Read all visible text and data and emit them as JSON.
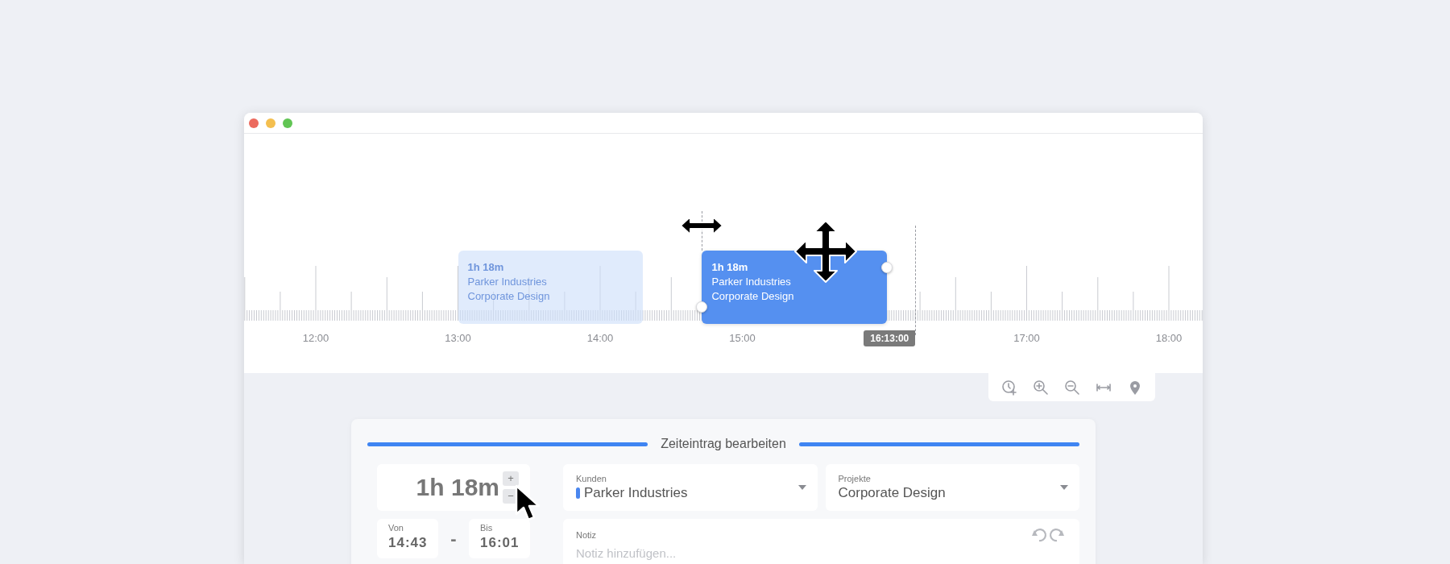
{
  "timeline": {
    "hour_labels": [
      "12:00",
      "13:00",
      "14:00",
      "15:00",
      "17:00",
      "18:00"
    ],
    "entries": [
      {
        "kind": "ghost",
        "duration": "1h 18m",
        "client": "Parker Industries",
        "project": "Corporate Design"
      },
      {
        "kind": "active",
        "duration": "1h 18m",
        "client": "Parker Industries",
        "project": "Corporate Design"
      }
    ],
    "now_marker": "16:13:00"
  },
  "editor": {
    "title": "Zeiteintrag bearbeiten",
    "duration": {
      "value": "1h 18m",
      "increment": "+",
      "decrement": "−"
    },
    "from": {
      "label": "Von",
      "value": "14:43"
    },
    "separator": "-",
    "to": {
      "label": "Bis",
      "value": "16:01"
    },
    "client": {
      "label": "Kunden",
      "value": "Parker Industries",
      "color": "#4a86ef"
    },
    "project": {
      "label": "Projekte",
      "value": "Corporate Design"
    },
    "note": {
      "label": "Notiz",
      "placeholder": "Notiz hinzufügen..."
    }
  }
}
